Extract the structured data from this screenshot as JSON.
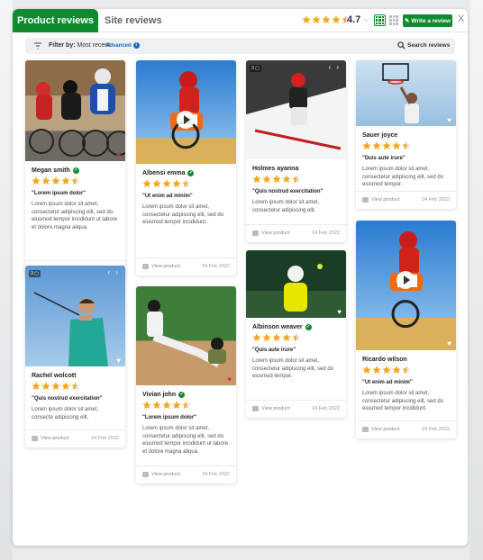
{
  "colors": {
    "brand": "#0f8a2e",
    "star": "#f4a71d",
    "link": "#1a66c8"
  },
  "header": {
    "tabs": [
      {
        "label": "Product reviews",
        "active": true
      },
      {
        "label": "Site reviews",
        "active": false
      }
    ],
    "rating": "4.7",
    "rating_stars": 4.5,
    "write_review_label": "Write a review",
    "close_label": "X"
  },
  "filter": {
    "label": "Filter by:",
    "value": "Most recent",
    "advanced": "Advanced",
    "search_label": "Search reviews"
  },
  "reviews": [
    {
      "name": "Megan smith",
      "verified": true,
      "stars": 4.5,
      "title": "\"Lorem ipsum dolor\"",
      "body": "Lorem ipsum dolor sit amet, consectetur adipiscing elit, sed do eiusmod tempor incididunt ut labore et dolore magna aliqua.",
      "view_product": "View product",
      "date": "24 Feb 2022",
      "image": "cyclists",
      "heart_filled": true
    },
    {
      "name": "Rachel wolcott",
      "verified": false,
      "stars": 4.5,
      "title": "\"Quis nostrud exercitation\"",
      "body": "Lorem ipsum dolor sit amet, consecte adipiscing elit.",
      "view_product": "View product",
      "date": "24 Feb 2022",
      "image": "golfer",
      "media_count": "3",
      "heart_filled": false
    },
    {
      "name": "Albensi emma",
      "verified": true,
      "stars": 4.5,
      "title": "\"Ut enim ad minim\"",
      "body": "Lorem ipsum dolor sit amet, consectetur adipiscing elit, sed do eiusmod tempor incididunt.",
      "view_product": "View product",
      "date": "24 Feb 2022",
      "image": "motocross",
      "heart_filled": false
    },
    {
      "name": "Vivian john",
      "verified": true,
      "stars": 4.5,
      "title": "\"Lorem ipsum dolor\"",
      "body": "Lorem ipsum dolor sit amet, consectetur adipiscing elit, sed do eiusmod tempor incididunt ut labore et dolore magna aliqua.",
      "view_product": "View product",
      "date": "24 Feb 2022",
      "image": "baseball",
      "heart_filled": true
    },
    {
      "name": "Holmes ayanna",
      "verified": false,
      "stars": 4.5,
      "title": "\"Quis nostrud exercitation\"",
      "body": "Lorem ipsum dolor sit amet, consectetur adipiscing elit.",
      "view_product": "View product",
      "date": "24 Feb 2022",
      "image": "skier",
      "media_count": "3",
      "heart_filled": false
    },
    {
      "name": "Albinson weaver",
      "verified": true,
      "stars": 4.5,
      "title": "\"Quis aute irure\"",
      "body": "Lorem ipsum dolor sit amet, consectetur adipiscing elit, sed do eiusmod tempor.",
      "view_product": "View product",
      "date": "24 Feb 2022",
      "image": "tennis",
      "heart_filled": false
    },
    {
      "name": "Sauer joyce",
      "verified": false,
      "stars": 4.5,
      "title": "\"Duis aute irure\"",
      "body": "Lorem ipsum dolor sit amet, consectetur adipiscing elit, sed do eiusmod tempor.",
      "view_product": "View product",
      "date": "24 Feb 2022",
      "image": "basketball",
      "heart_filled": false
    },
    {
      "name": "Ricardo wilson",
      "verified": false,
      "stars": 4.5,
      "title": "\"Ut enim ad minim\"",
      "body": "Lorem ipsum dolor sit amet, consectetur adipiscing elit, sed do eiusmod tempor incididunt.",
      "view_product": "View product",
      "date": "24 Feb 2022",
      "image": "motocross",
      "heart_filled": false
    }
  ]
}
